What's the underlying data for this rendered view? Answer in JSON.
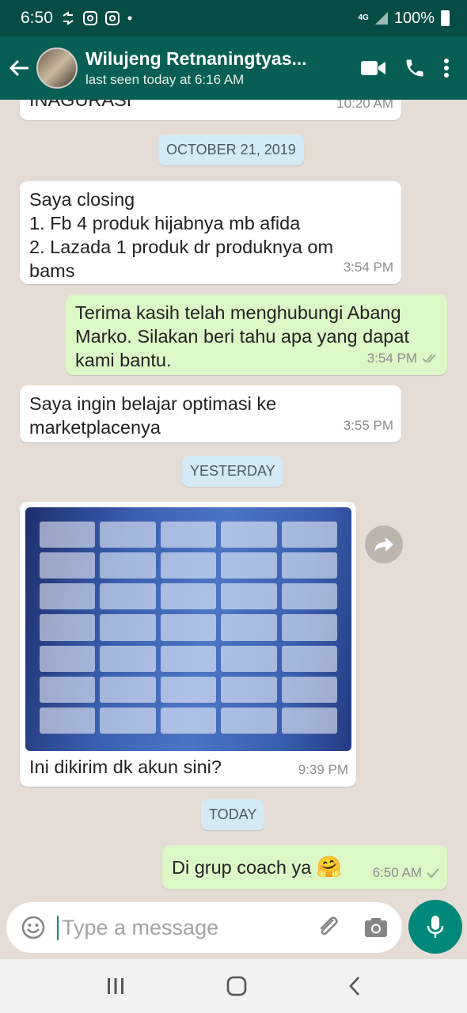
{
  "status_bar": {
    "time": "6:50",
    "network": "4G",
    "battery": "100%"
  },
  "header": {
    "contact_name": "Wilujeng Retnaningtyas...",
    "last_seen": "last seen today at 6:16 AM"
  },
  "messages": {
    "partial_top": {
      "text": "INAGURASI",
      "time": "10:20 AM"
    },
    "date1": "OCTOBER 21, 2019",
    "m1": {
      "lines": [
        "Saya closing",
        "1. Fb 4 produk hijabnya mb afida",
        "2. Lazada 1 produk dr produknya om",
        "bams"
      ],
      "time": "3:54 PM"
    },
    "m2": {
      "lines": [
        "Terima kasih telah menghubungi Abang",
        "Marko. Silakan beri tahu apa yang dapat",
        "kami bantu."
      ],
      "time": "3:54 PM",
      "status": "read"
    },
    "m3": {
      "lines": [
        "Saya ingin belajar optimasi ke",
        "marketplacenya"
      ],
      "time": "3:55 PM"
    },
    "date2": "YESTERDAY",
    "m4": {
      "caption": "Ini dikirim dk akun sini?",
      "time": "9:39 PM"
    },
    "date3": "TODAY",
    "m5": {
      "text": "Di grup coach ya",
      "emoji": "🤗",
      "time": "6:50 AM",
      "status": "delivered"
    }
  },
  "input": {
    "placeholder": "Type a message"
  },
  "colors": {
    "header": "#075e54",
    "statusbar": "#054d44",
    "outgoing": "#dcf8c6",
    "incoming": "#ffffff",
    "accent": "#00897b",
    "date_chip": "#d4eaf4"
  }
}
